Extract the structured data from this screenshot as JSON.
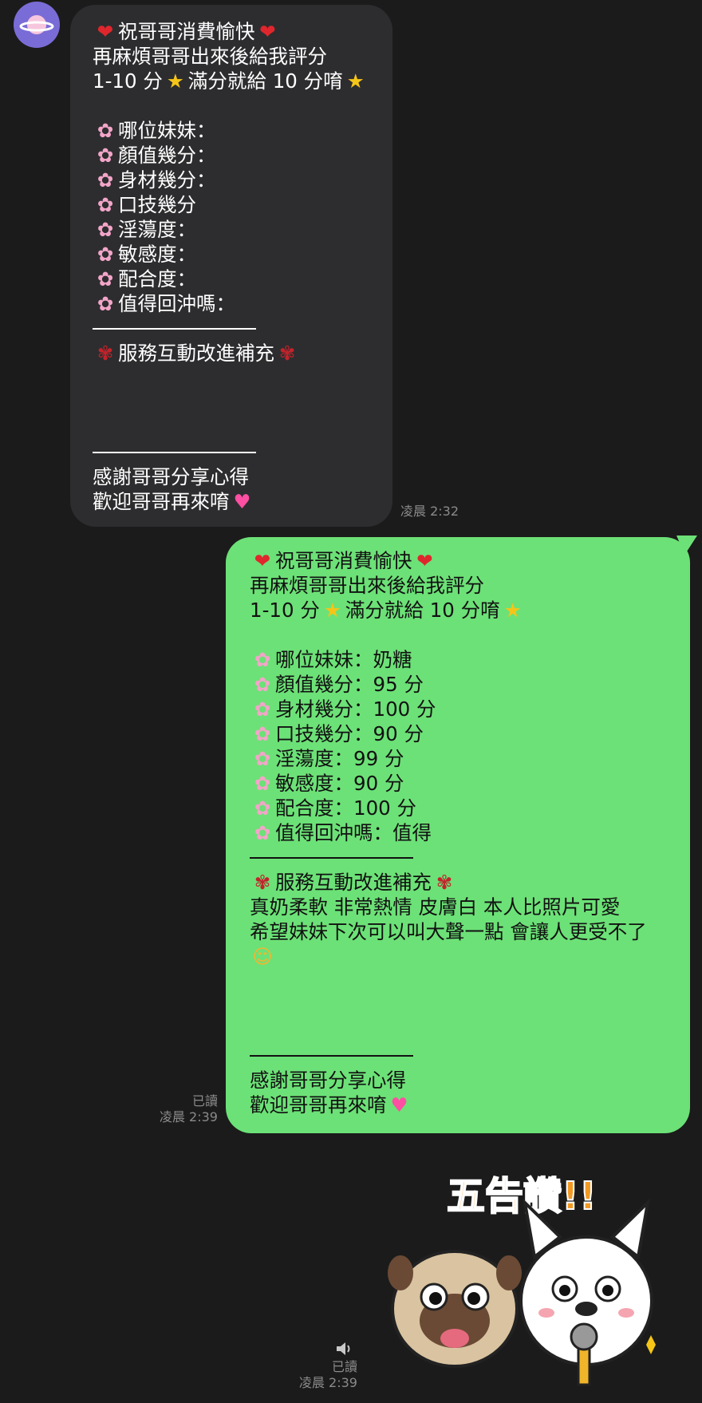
{
  "incoming": {
    "avatar_icon": "planet-icon",
    "timestamp": "凌晨 2:32",
    "emoji_line1": "❤",
    "line1": "祝哥哥消費愉快",
    "line2": "再麻煩哥哥出來後給我評分",
    "line3_a": "1-10 分",
    "line3_b": "滿分就給 10 分唷",
    "items": [
      "哪位妹妹：",
      "顏值幾分：",
      "身材幾分：",
      "口技幾分",
      "淫蕩度：",
      "敏感度：",
      "配合度：",
      "值得回沖嗎："
    ],
    "section_title": "服務互動改進補充",
    "thanks1": "感謝哥哥分享心得",
    "thanks2": "歡迎哥哥再來唷"
  },
  "outgoing": {
    "read_label": "已讀",
    "timestamp": "凌晨 2:39",
    "line1": "祝哥哥消費愉快",
    "line2": "再麻煩哥哥出來後給我評分",
    "line3_a": "1-10 分",
    "line3_b": "滿分就給 10 分唷",
    "items": [
      "哪位妹妹：奶糖",
      "顏值幾分：95 分",
      "身材幾分：100 分",
      "口技幾分：90 分",
      "淫蕩度：99 分",
      "敏感度：90 分",
      "配合度：100 分",
      "值得回沖嗎：值得"
    ],
    "section_title": "服務互動改進補充",
    "comment1": "真奶柔軟 非常熱情 皮膚白 本人比照片可愛",
    "comment2": "希望妹妹下次可以叫大聲一點 會讓人更受不了",
    "thanks1": "感謝哥哥分享心得",
    "thanks2": "歡迎哥哥再來唷"
  },
  "sticker": {
    "caption": "五告讚!!",
    "read_label": "已讀",
    "timestamp": "凌晨 2:39",
    "speaker_icon": "speaker-icon"
  },
  "colors": {
    "background": "#1b1b1b",
    "incoming_bubble": "#2d2d2f",
    "outgoing_bubble": "#6ce177",
    "meta_text": "#8a8a8a"
  }
}
